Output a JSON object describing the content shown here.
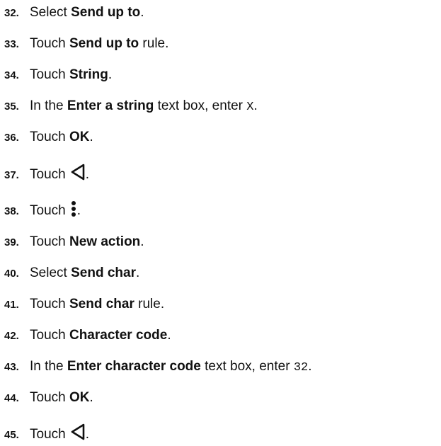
{
  "steps": [
    {
      "num": "32.",
      "pre": "Select ",
      "bold": "Send up to",
      "post": "."
    },
    {
      "num": "33.",
      "pre": "Touch ",
      "bold": "Send up to",
      "post": " rule."
    },
    {
      "num": "34.",
      "pre": "Touch ",
      "bold": "String",
      "post": "."
    },
    {
      "num": "35.",
      "pre": "In the ",
      "bold": "Enter a string",
      "mid": " text box, enter ",
      "code": "X",
      "post": "."
    },
    {
      "num": "36.",
      "pre": "Touch ",
      "bold": "OK",
      "post": "."
    },
    {
      "num": "37.",
      "pre": "Touch",
      "icon": "back-triangle-icon",
      "post": "."
    },
    {
      "num": "38.",
      "pre": "Touch",
      "icon": "more-vertical-icon",
      "post": "."
    },
    {
      "num": "39.",
      "pre": "Touch ",
      "bold": "New action",
      "post": "."
    },
    {
      "num": "40.",
      "pre": "Select ",
      "bold": "Send char",
      "post": "."
    },
    {
      "num": "41.",
      "pre": "Touch ",
      "bold": "Send char",
      "post": " rule."
    },
    {
      "num": "42.",
      "pre": "Touch ",
      "bold": "Character code",
      "post": "."
    },
    {
      "num": "43.",
      "pre": "In the ",
      "bold": "Enter character code",
      "mid": " text box, enter ",
      "code": "32",
      "post": "."
    },
    {
      "num": "44.",
      "pre": "Touch ",
      "bold": "OK",
      "post": "."
    },
    {
      "num": "45.",
      "pre": "Touch",
      "icon": "back-triangle-icon",
      "post": "."
    }
  ]
}
